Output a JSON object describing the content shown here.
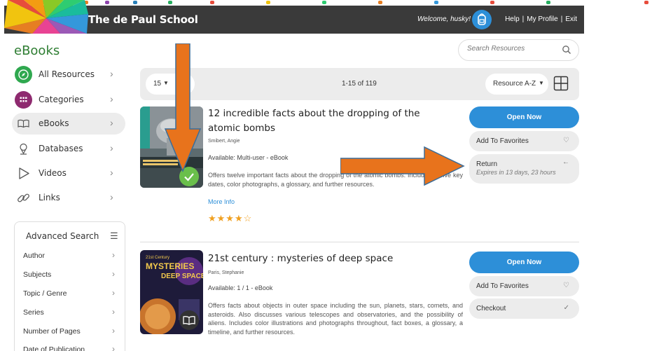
{
  "header": {
    "school_name": "The de Paul School",
    "welcome": "Welcome, husky!",
    "links": [
      "Help",
      "My Profile",
      "Exit"
    ]
  },
  "page": {
    "title": "eBooks"
  },
  "search": {
    "placeholder": "Search Resources"
  },
  "sidebar": {
    "items": [
      {
        "label": "All Resources",
        "icon": "compass-icon",
        "color": "#2fa84f"
      },
      {
        "label": "Categories",
        "icon": "grid-icon",
        "color": "#8e2a6f"
      },
      {
        "label": "eBooks",
        "icon": "book-open-icon",
        "active": true
      },
      {
        "label": "Databases",
        "icon": "database-icon"
      },
      {
        "label": "Videos",
        "icon": "play-icon"
      },
      {
        "label": "Links",
        "icon": "link-icon"
      }
    ]
  },
  "advanced_search": {
    "title": "Advanced Search",
    "rows": [
      "Author",
      "Subjects",
      "Topic / Genre",
      "Series",
      "Number of Pages",
      "Date of Publication"
    ]
  },
  "toolbar": {
    "per_page": "15",
    "per_page_suffix": "/ p",
    "count": "1-15 of 119",
    "sort": "Resource A-Z"
  },
  "results": [
    {
      "title": "12 incredible facts about the dropping of the atomic bombs",
      "author": "Smibert, Angie",
      "availability": "Available: Multi-user - eBook",
      "description": "Offers twelve important facts about the dropping of the atomic bombs. Includes twelve key dates, color photographs, a glossary, and further resources.",
      "more": "More Info",
      "stars": "★★★★☆",
      "rating": 4,
      "open": "Open Now",
      "favorite": "Add To Favorites",
      "action": "Return",
      "action_sub": "Expires in 13 days, 23 hours"
    },
    {
      "title": "21st century : mysteries of deep space",
      "author": "Paris, Stephanie",
      "availability": "Available: 1 / 1 - eBook",
      "description": "Offers facts about objects in outer space including the sun, planets, stars, comets, and asteroids. Also discusses various telescopes and observatories, and the possibility of aliens. Includes color illustrations and photographs throughout, fact boxes, a glossary, a timeline, and further resources.",
      "open": "Open Now",
      "favorite": "Add To Favorites",
      "action": "Checkout",
      "cover_text": [
        "21st Century",
        "MYSTERIES",
        "DEEP SPACE"
      ]
    }
  ],
  "colors": {
    "header_bg": "#3a3a3a",
    "accent_blue": "#2d8fd8",
    "brand_green": "#2e7d32",
    "arrow_orange": "#e8731c"
  }
}
